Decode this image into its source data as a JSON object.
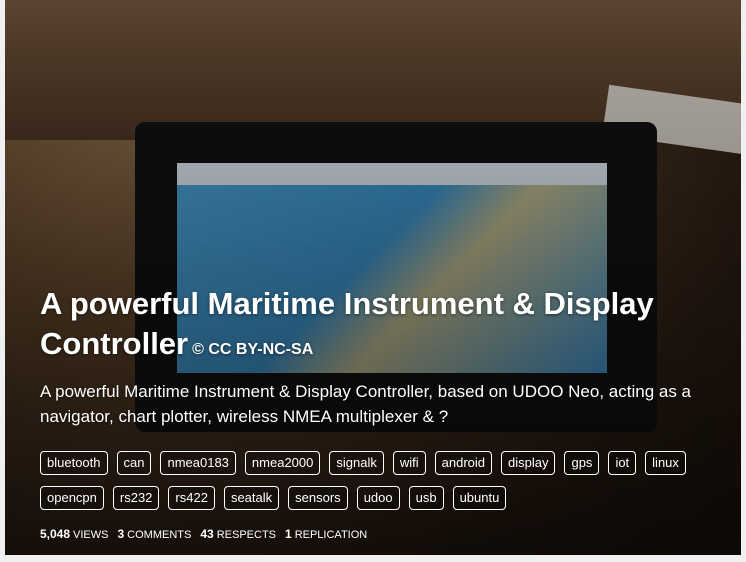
{
  "title": "A powerful Maritime Instrument & Display Controller",
  "license": "© CC BY-NC-SA",
  "description": "A powerful Maritime Instrument & Display Controller, based on UDOO Neo, acting as a navigator, chart plotter, wireless NMEA multiplexer & ?",
  "tags": [
    "bluetooth",
    "can",
    "nmea0183",
    "nmea2000",
    "signalk",
    "wifi",
    "android",
    "display",
    "gps",
    "iot",
    "linux",
    "opencpn",
    "rs232",
    "rs422",
    "seatalk",
    "sensors",
    "udoo",
    "usb",
    "ubuntu"
  ],
  "stats": [
    {
      "value": "5,048",
      "label": "VIEWS"
    },
    {
      "value": "3",
      "label": "COMMENTS"
    },
    {
      "value": "43",
      "label": "RESPECTS"
    },
    {
      "value": "1",
      "label": "REPLICATION"
    }
  ]
}
